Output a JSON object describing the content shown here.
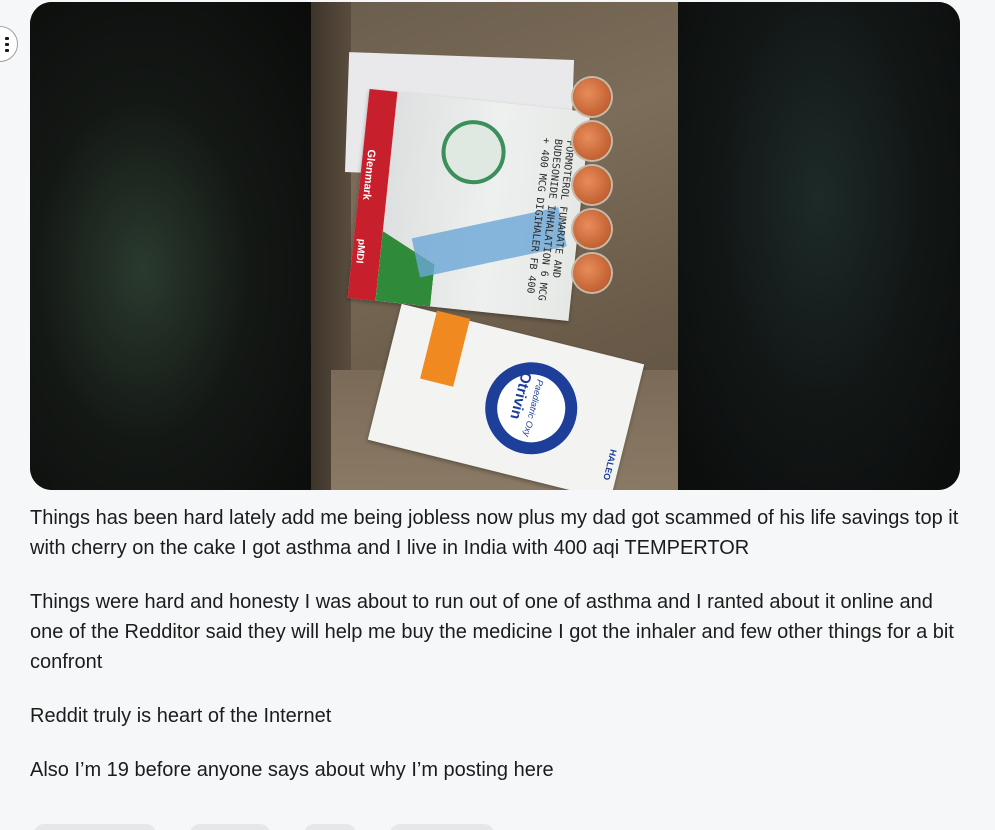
{
  "media": {
    "inhaler_box": {
      "brand": "Glenmark",
      "type": "pMDI",
      "drug_text": "FORMOTEROL FUMARATE AND BUDESONIDE INHALATION 6 MCG + 400 MCG DIGIHALER FB 400"
    },
    "spray_box": {
      "brand": "Otrivin",
      "variant": "Paediatric",
      "variant_line2": "Oxy",
      "maker": "HALEO"
    }
  },
  "post": {
    "paragraphs": [
      "Things has been hard lately add me being jobless now plus my dad got scammed of his life savings top it with cherry on the cake I got asthma and I live in India with 400 aqi TEMPERTOR",
      "Things were hard and honesty I was about to run out of one of asthma and I ranted about it online and one of the Redditor said they will help me buy the medicine I got the inhaler and few other things for a bit confront",
      "Reddit truly is heart of the Internet",
      "Also I’m 19 before anyone says about why I’m posting here"
    ]
  },
  "icons": {
    "more_options": "more-vertical-icon"
  }
}
